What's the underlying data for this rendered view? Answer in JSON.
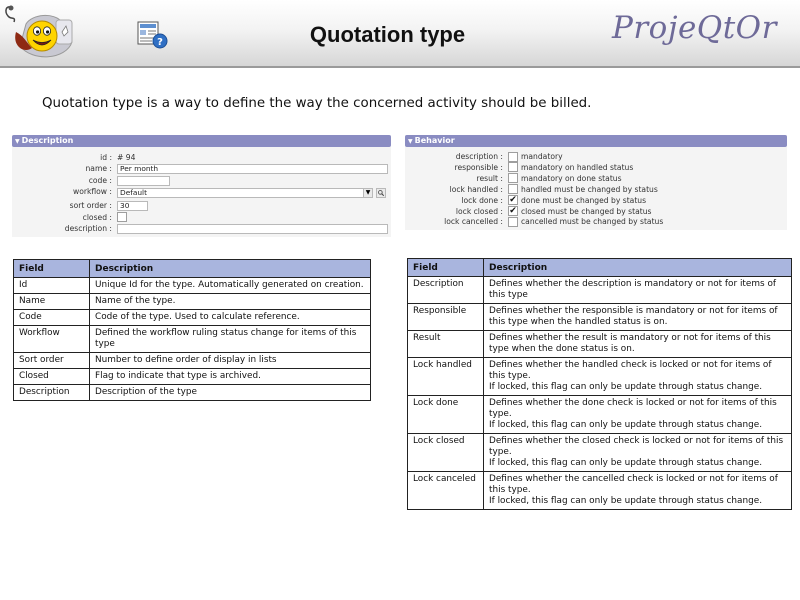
{
  "header": {
    "title": "Quotation type",
    "brand": "ProjeQtOr"
  },
  "intro": "Quotation type is a way to define the way the concerned activity should be billed.",
  "description_panel": {
    "title": "Description",
    "fields": {
      "id": {
        "label": "id :",
        "value": "# 94"
      },
      "name": {
        "label": "name :",
        "value": "Per month"
      },
      "code": {
        "label": "code :",
        "value": ""
      },
      "workflow": {
        "label": "workflow :",
        "value": "Default"
      },
      "sort_order": {
        "label": "sort order :",
        "value": "30"
      },
      "closed": {
        "label": "closed :",
        "checked": false
      },
      "description": {
        "label": "description :",
        "value": ""
      }
    }
  },
  "behavior_panel": {
    "title": "Behavior",
    "rows": [
      {
        "label": "description :",
        "text": "mandatory",
        "checked": false
      },
      {
        "label": "responsible :",
        "text": "mandatory on handled status",
        "checked": false
      },
      {
        "label": "result :",
        "text": "mandatory on done status",
        "checked": false
      },
      {
        "label": "lock handled :",
        "text": "handled must be changed by status",
        "checked": false
      },
      {
        "label": "lock done :",
        "text": "done must be changed by status",
        "checked": true
      },
      {
        "label": "lock closed :",
        "text": "closed must be changed by status",
        "checked": true
      },
      {
        "label": "lock cancelled :",
        "text": "cancelled must be changed by status",
        "checked": false
      }
    ]
  },
  "left_table": {
    "headers": [
      "Field",
      "Description"
    ],
    "rows": [
      {
        "field": "Id",
        "desc": "Unique Id for the type. Automatically generated on creation."
      },
      {
        "field": "Name",
        "desc": "Name of the type."
      },
      {
        "field": "Code",
        "desc": "Code of the type. Used to calculate reference."
      },
      {
        "field": "Workflow",
        "desc": "Defined the workflow ruling status change for items of this type"
      },
      {
        "field": "Sort order",
        "desc": "Number to define order of display in lists"
      },
      {
        "field": "Closed",
        "desc": "Flag to indicate that type is archived."
      },
      {
        "field": "Description",
        "desc": "Description of the type"
      }
    ]
  },
  "right_table": {
    "headers": [
      "Field",
      "Description"
    ],
    "rows": [
      {
        "field": "Description",
        "desc": "Defines whether the description is mandatory or not for items of this type",
        "note": ""
      },
      {
        "field": "Responsible",
        "desc": "Defines whether the responsible is mandatory or not for items of this type when the handled status is on.",
        "note": ""
      },
      {
        "field": "Result",
        "desc": "Defines whether the result is mandatory or not for items of this type when the done status is on.",
        "note": ""
      },
      {
        "field": "Lock handled",
        "desc": "Defines whether the handled check is locked or not for items of this type.",
        "note": "If locked, this flag can only be update through status change."
      },
      {
        "field": "Lock done",
        "desc": "Defines whether the done check is locked or not for items of this type.",
        "note": "If locked, this flag can only be update through status change."
      },
      {
        "field": "Lock closed",
        "desc": "Defines whether the closed check is locked or not for items of this type.",
        "note": "If locked, this flag can only be update through status change."
      },
      {
        "field": "Lock canceled",
        "desc": "Defines whether the cancelled check is locked or not for items of this type.",
        "note": "If locked, this flag can only be update through status change."
      }
    ]
  },
  "colors": {
    "panel_header": "#8a8cc2",
    "table_header": "#a9b5de",
    "brand": "#6e6a98"
  },
  "icons": [
    "smiley-logo-icon",
    "help-document-icon",
    "dropdown-arrow-icon",
    "search-icon",
    "checkmark-icon"
  ]
}
